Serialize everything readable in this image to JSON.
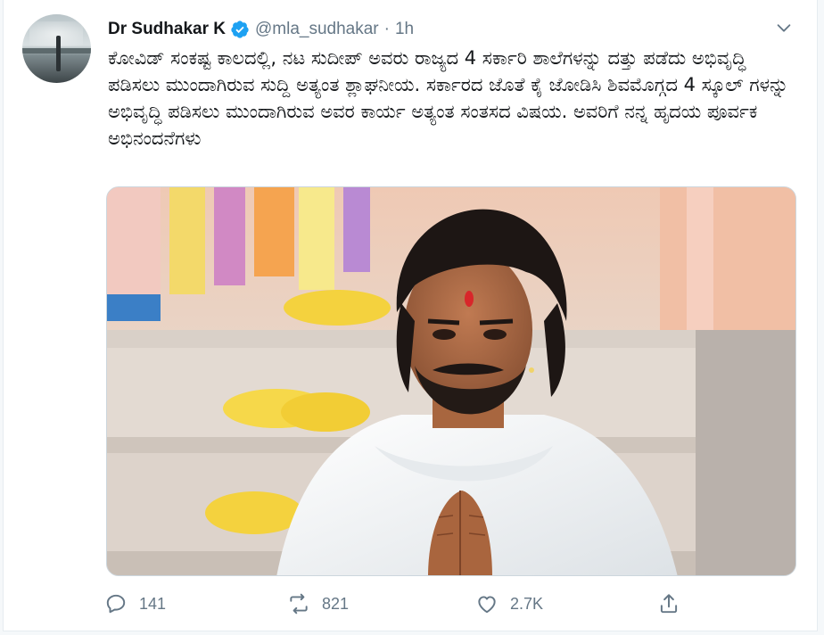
{
  "author": {
    "name": "Dr Sudhakar K",
    "handle": "@mla_sudhakar",
    "separator": "·",
    "time": "1h",
    "verified": true,
    "avatar_icon": "avatar-photo"
  },
  "tweet": {
    "text": "ಕೋವಿಡ್ ಸಂಕಷ್ಟ ಕಾಲದಲ್ಲಿ, ನಟ ಸುದೀಪ್ ಅವರು ರಾಜ್ಯದ 4 ಸರ್ಕಾರಿ ಶಾಲೆಗಳನ್ನು ದತ್ತು ಪಡೆದು ಅಭಿವೃದ್ಧಿ ಪಡಿಸಲು ಮುಂದಾಗಿರುವ ಸುದ್ದಿ ಅತ್ಯಂತ ಶ್ಲಾಘನೀಯ. ಸರ್ಕಾರದ ಜೊತೆ ಕೈ ಜೋಡಿಸಿ ಶಿವಮೊಗ್ಗದ 4 ಸ್ಕೂಲ್ ಗಳನ್ನು ಅಭಿವೃದ್ಧಿ ಪಡಿಸಲು ಮುಂದಾಗಿರುವ ಅವರ ಕಾರ್ಯ ಅತ್ಯಂತ ಸಂತಸದ ವಿಷಯ. ಅವರಿಗೆ ನನ್ನ ಹೃದಯ ಪೂರ್ವಕ ಅಭಿನಂದನೆಗಳು"
  },
  "actions": {
    "reply": {
      "icon": "reply-icon",
      "count": "141"
    },
    "retweet": {
      "icon": "retweet-icon",
      "count": "821"
    },
    "like": {
      "icon": "heart-icon",
      "count": "2.7K"
    },
    "share": {
      "icon": "share-icon",
      "count": ""
    }
  },
  "colors": {
    "text": "#14171a",
    "secondary": "#657786",
    "verified": "#1da1f2",
    "border": "#e6ecf0"
  }
}
